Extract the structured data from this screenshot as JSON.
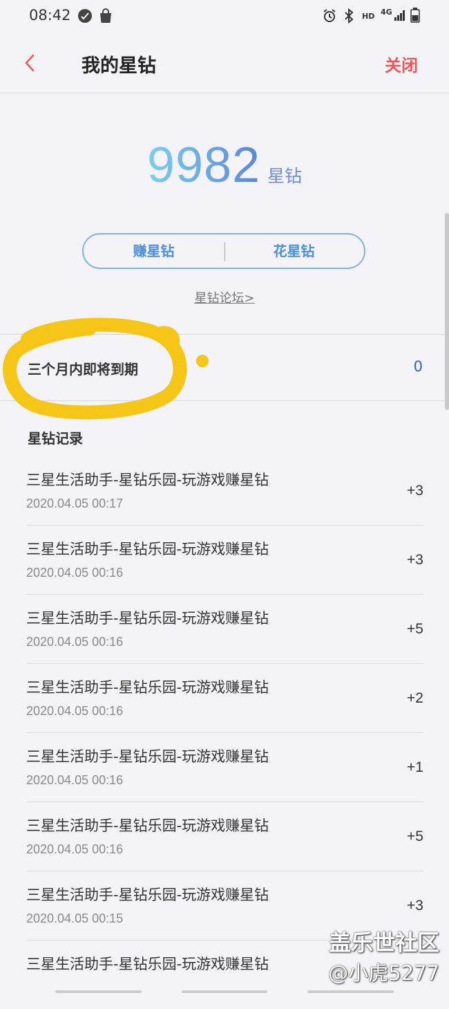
{
  "status_bar": {
    "time": "08:42",
    "hd": "HD",
    "net": "4G"
  },
  "header": {
    "back_icon": "chevron-left-icon",
    "title": "我的星钻",
    "close_label": "关闭"
  },
  "balance": {
    "value": "9982",
    "unit": "星钻"
  },
  "actions": {
    "earn_label": "赚星钻",
    "spend_label": "花星钻"
  },
  "forum_link": "星钻论坛>",
  "expiring": {
    "label": "三个月内即将到期",
    "value": "0"
  },
  "records": {
    "title": "星钻记录",
    "items": [
      {
        "name": "三星生活助手-星钻乐园-玩游戏赚星钻",
        "time": "2020.04.05 00:17",
        "amount": "+3"
      },
      {
        "name": "三星生活助手-星钻乐园-玩游戏赚星钻",
        "time": "2020.04.05 00:16",
        "amount": "+3"
      },
      {
        "name": "三星生活助手-星钻乐园-玩游戏赚星钻",
        "time": "2020.04.05 00:16",
        "amount": "+5"
      },
      {
        "name": "三星生活助手-星钻乐园-玩游戏赚星钻",
        "time": "2020.04.05 00:16",
        "amount": "+2"
      },
      {
        "name": "三星生活助手-星钻乐园-玩游戏赚星钻",
        "time": "2020.04.05 00:16",
        "amount": "+1"
      },
      {
        "name": "三星生活助手-星钻乐园-玩游戏赚星钻",
        "time": "2020.04.05 00:16",
        "amount": "+5"
      },
      {
        "name": "三星生活助手-星钻乐园-玩游戏赚星钻",
        "time": "2020.04.05 00:15",
        "amount": "+3"
      },
      {
        "name": "三星生活助手-星钻乐园-玩游戏赚星钻",
        "time": "",
        "amount": ""
      }
    ]
  },
  "watermark": {
    "line1": "盖乐世社区",
    "line2": "@小虎5277"
  },
  "colors": {
    "accent": "#4a90dd",
    "close": "#e85a5a",
    "highlight": "#f5c518"
  }
}
